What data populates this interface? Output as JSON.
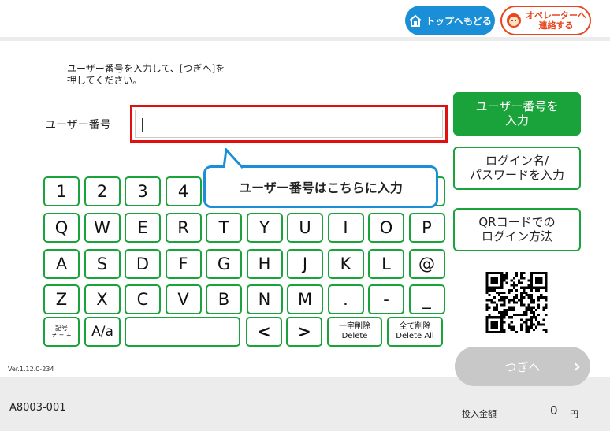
{
  "header": {
    "home_button": "トップへもどる",
    "operator_button": [
      "オペレーターへ",
      "連絡する"
    ]
  },
  "instruction": [
    "ユーザー番号を入力して、[つぎへ]を",
    "押してください。"
  ],
  "input": {
    "label": "ユーザー番号",
    "value": ""
  },
  "tooltip": "ユーザー番号はこちらに入力",
  "keyboard": {
    "row1": [
      "1",
      "2",
      "3",
      "4"
    ],
    "row2": [
      "Q",
      "W",
      "E",
      "R",
      "T",
      "Y",
      "U",
      "I",
      "O",
      "P"
    ],
    "row3": [
      "A",
      "S",
      "D",
      "F",
      "G",
      "H",
      "J",
      "K",
      "L",
      "@"
    ],
    "row4": [
      "Z",
      "X",
      "C",
      "V",
      "B",
      "N",
      "M",
      ".",
      "-",
      "_"
    ],
    "symbol_key": [
      "記号",
      "≠ = +"
    ],
    "case_key": "A/a",
    "left_key": "<",
    "right_key": ">",
    "delete_key": [
      "一字削除",
      "Delete"
    ],
    "delete_all_key": [
      "全て削除",
      "Delete All"
    ]
  },
  "side": {
    "user_number": [
      "ユーザー番号を",
      "入力"
    ],
    "login_name": [
      "ログイン名/",
      "パスワードを入力"
    ],
    "qr": [
      "QRコードでの",
      "ログイン方法"
    ]
  },
  "next_button": "つぎへ",
  "version": "Ver.1.12.0-234",
  "footer": {
    "terminal_id": "A8003-001",
    "amount_label": "投入金額",
    "amount": "0",
    "currency": "円"
  },
  "colors": {
    "green": "#1aa33a",
    "blue": "#1a8fd8",
    "orange": "#e8461e",
    "red": "#e01010"
  }
}
